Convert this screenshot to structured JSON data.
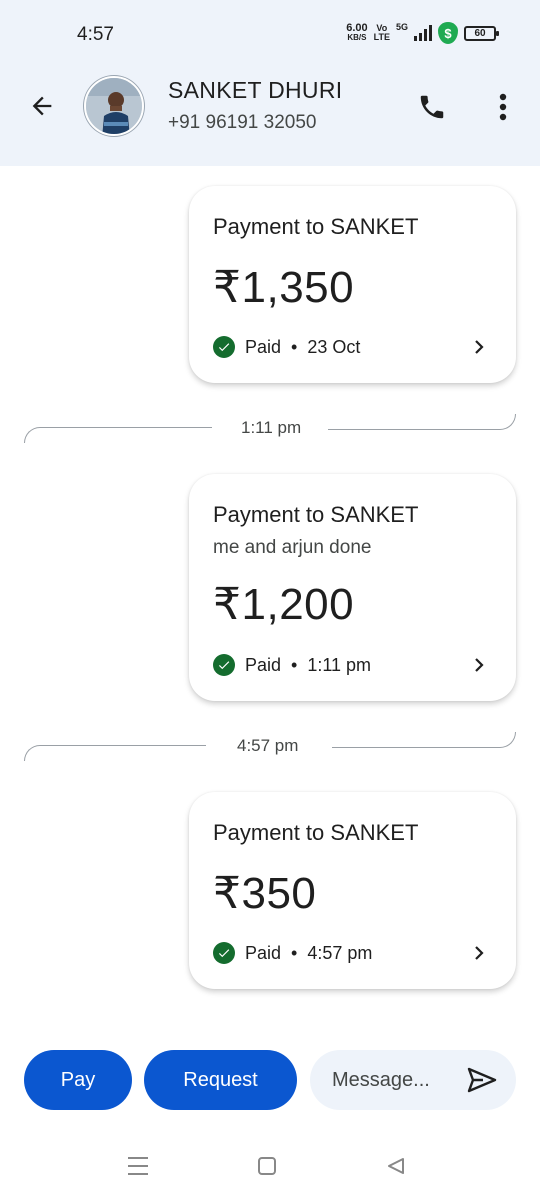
{
  "status_bar": {
    "time": "4:57",
    "net_speed_value": "6.00",
    "net_speed_unit": "KB/S",
    "volte_top": "Vo",
    "volte_bottom": "LTE",
    "network": "5G",
    "battery": "60"
  },
  "header": {
    "contact_name": "SANKET DHURI",
    "contact_phone": "+91 96191 32050"
  },
  "messages": [
    {
      "title": "Payment to SANKET",
      "note": "",
      "amount": "₹1,350",
      "status": "Paid",
      "date": "23 Oct"
    },
    {
      "title": "Payment to SANKET",
      "note": "me and arjun done",
      "amount": "₹1,200",
      "status": "Paid",
      "date": "1:11 pm"
    },
    {
      "title": "Payment to SANKET",
      "note": "",
      "amount": "₹350",
      "status": "Paid",
      "date": "4:57 pm"
    }
  ],
  "separators": [
    "1:11 pm",
    "4:57 pm"
  ],
  "bottom_bar": {
    "pay_label": "Pay",
    "request_label": "Request",
    "message_placeholder": "Message..."
  },
  "colors": {
    "primary": "#0b57d0",
    "header_bg": "#eef3fa",
    "paid_green": "#146c2e",
    "shield_green": "#1faa52"
  },
  "icons": {
    "back": "arrow-left-icon",
    "call": "phone-icon",
    "more": "more-vert-icon",
    "paid": "check-circle-icon",
    "chevron": "chevron-right-icon",
    "send": "send-icon"
  }
}
